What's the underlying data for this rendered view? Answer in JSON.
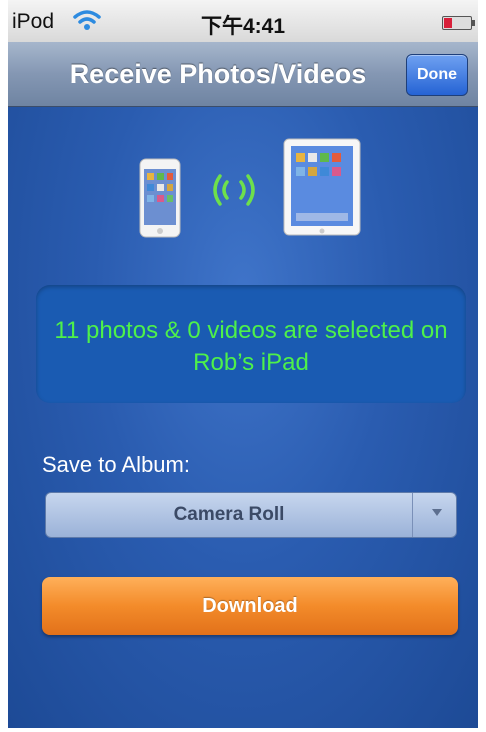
{
  "status_bar": {
    "carrier": "iPod",
    "time": "下午4:41"
  },
  "nav": {
    "title": "Receive Photos/Videos",
    "done_label": "Done"
  },
  "info": {
    "message": "11 photos & 0 videos are selected on Rob’s iPad"
  },
  "album": {
    "label": "Save to Album:",
    "selected": "Camera Roll"
  },
  "actions": {
    "download_label": "Download"
  },
  "icons": [
    "wifi-icon",
    "battery-icon",
    "iphone-icon",
    "ipad-icon",
    "wireless-waves-icon",
    "dropdown-arrow-icon"
  ],
  "colors": {
    "background": "#2a5cb0",
    "info_text": "#4ef14a",
    "download": "#f38b2a",
    "done_button": "#2563d4"
  }
}
